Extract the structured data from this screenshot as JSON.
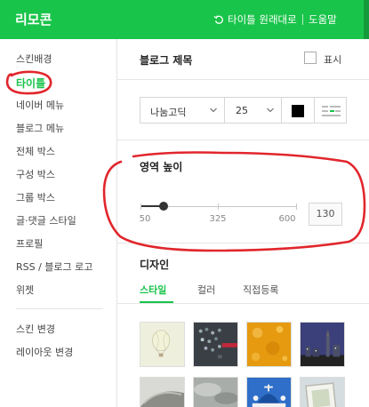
{
  "header": {
    "title": "리모콘",
    "reset_label": "타이틀 원래대로",
    "help_label": "도움말",
    "bg_color": "#19c44a"
  },
  "sidebar": {
    "items": [
      {
        "label": "스킨배경"
      },
      {
        "label": "타이틀",
        "active": true
      },
      {
        "label": "네이버 메뉴"
      },
      {
        "label": "블로그 메뉴"
      },
      {
        "label": "전체 박스"
      },
      {
        "label": "구성 박스"
      },
      {
        "label": "그룹 박스"
      },
      {
        "label": "글·댓글 스타일"
      },
      {
        "label": "프로필"
      },
      {
        "label": "RSS / 블로그 로고"
      },
      {
        "label": "위젯"
      }
    ],
    "bottom_items": [
      {
        "label": "스킨 변경"
      },
      {
        "label": "레이아웃 변경"
      }
    ]
  },
  "blog_title": {
    "label": "블로그 제목",
    "show_label": "표시",
    "show_checked": false
  },
  "font": {
    "family": "나눔고딕",
    "size": "25",
    "color": "#000000",
    "align_icon": "text-align-icon"
  },
  "height": {
    "label": "영역 높이",
    "min": "50",
    "mid": "325",
    "max": "600",
    "value": "130",
    "fraction": 0.145
  },
  "design": {
    "label": "디자인",
    "tabs": [
      {
        "label": "스타일",
        "active": true
      },
      {
        "label": "컬러"
      },
      {
        "label": "직접등록"
      }
    ]
  },
  "thumbnails": [
    {
      "name": "hot-air-balloon"
    },
    {
      "name": "dark-mosaic"
    },
    {
      "name": "orange-dots"
    },
    {
      "name": "night-city"
    },
    {
      "name": "car-bumper"
    },
    {
      "name": "cloudy-sky"
    },
    {
      "name": "santorini-dome"
    },
    {
      "name": "picture-frame"
    }
  ]
}
